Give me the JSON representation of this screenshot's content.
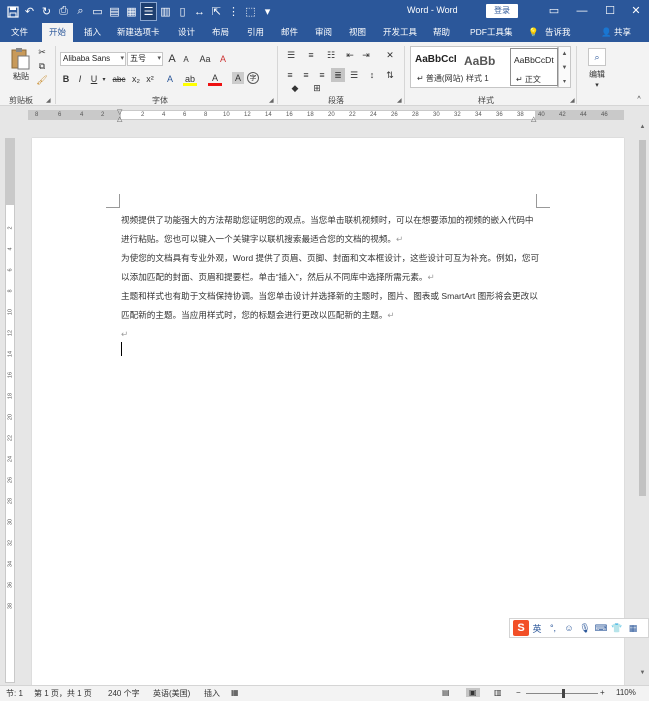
{
  "window": {
    "title": "Word - Word",
    "login": "登录",
    "minimize_icon": "minimize-icon",
    "restore_icon": "restore-icon",
    "close_icon": "close-icon",
    "minimize_glyph": "—",
    "restore_glyph": "☐",
    "close_glyph": "✕"
  },
  "tabs": [
    {
      "label": "文件"
    },
    {
      "label": "开始"
    },
    {
      "label": "插入"
    },
    {
      "label": "新建选项卡"
    },
    {
      "label": "设计"
    },
    {
      "label": "布局"
    },
    {
      "label": "引用"
    },
    {
      "label": "邮件"
    },
    {
      "label": "审阅"
    },
    {
      "label": "视图"
    },
    {
      "label": "开发工具"
    },
    {
      "label": "帮助"
    },
    {
      "label": "PDF工具集"
    },
    {
      "label": "告诉我"
    },
    {
      "label": "共享"
    }
  ],
  "ribbon": {
    "clipboard": {
      "paste": "粘贴",
      "label": "剪贴板"
    },
    "font": {
      "name": "Alibaba Sans",
      "size": "五号",
      "label": "字体",
      "grow": "A",
      "shrink": "A",
      "case": "Aa",
      "clear": "A",
      "bold": "B",
      "italic": "I",
      "underline": "U",
      "strike": "abc",
      "sub": "x₂",
      "sup": "x²",
      "effect": "A",
      "highlight": "ab",
      "color": "A",
      "shade": "A",
      "enclose": "字"
    },
    "paragraph": {
      "label": "段落"
    },
    "styles": {
      "label": "样式",
      "items": [
        {
          "sample": "AaBbCcI",
          "name": "↵ 普通(网站)"
        },
        {
          "sample": "AaBb",
          "name": "样式 1"
        },
        {
          "sample": "AaBbCcDt",
          "name": "↵ 正文"
        }
      ]
    },
    "editing": {
      "label": "编辑"
    }
  },
  "ruler": {
    "corner": "L",
    "ticks": [
      "8",
      "6",
      "4",
      "2",
      "2",
      "4",
      "6",
      "8",
      "10",
      "12",
      "14",
      "16",
      "18",
      "20",
      "22",
      "24",
      "26",
      "28",
      "30",
      "32",
      "34",
      "36",
      "38",
      "40",
      "42",
      "44",
      "46",
      "48"
    ],
    "vticks": [
      "2",
      "4",
      "6",
      "8",
      "10",
      "12",
      "14",
      "16",
      "18",
      "20",
      "22",
      "24",
      "26",
      "28",
      "30",
      "32",
      "34",
      "36",
      "38"
    ]
  },
  "document": {
    "paragraphs": [
      "视频提供了功能强大的方法帮助您证明您的观点。当您单击联机视频时，可以在想要添加的视频的嵌入代码中进行粘贴。您也可以键入一个关键字以联机搜索最适合您的文档的视频。",
      "为使您的文档具有专业外观，Word 提供了页眉、页脚、封面和文本框设计，这些设计可互为补充。例如，您可以添加匹配的封面、页眉和提要栏。单击“插入”，然后从不同库中选择所需元素。",
      "主题和样式也有助于文档保持协调。当您单击设计并选择新的主题时，图片、图表或 SmartArt 图形将会更改以匹配新的主题。当应用样式时，您的标题会进行更改以匹配新的主题。"
    ],
    "para_mark": "↵"
  },
  "ime": {
    "logo": "S",
    "lang": "英"
  },
  "status": {
    "section": "节: 1",
    "page": "第 1 页，共 1 页",
    "words": "240 个字",
    "language": "英语(美国)",
    "mode": "插入",
    "zoom": "110%",
    "zoom_minus": "−",
    "zoom_plus": "+"
  }
}
